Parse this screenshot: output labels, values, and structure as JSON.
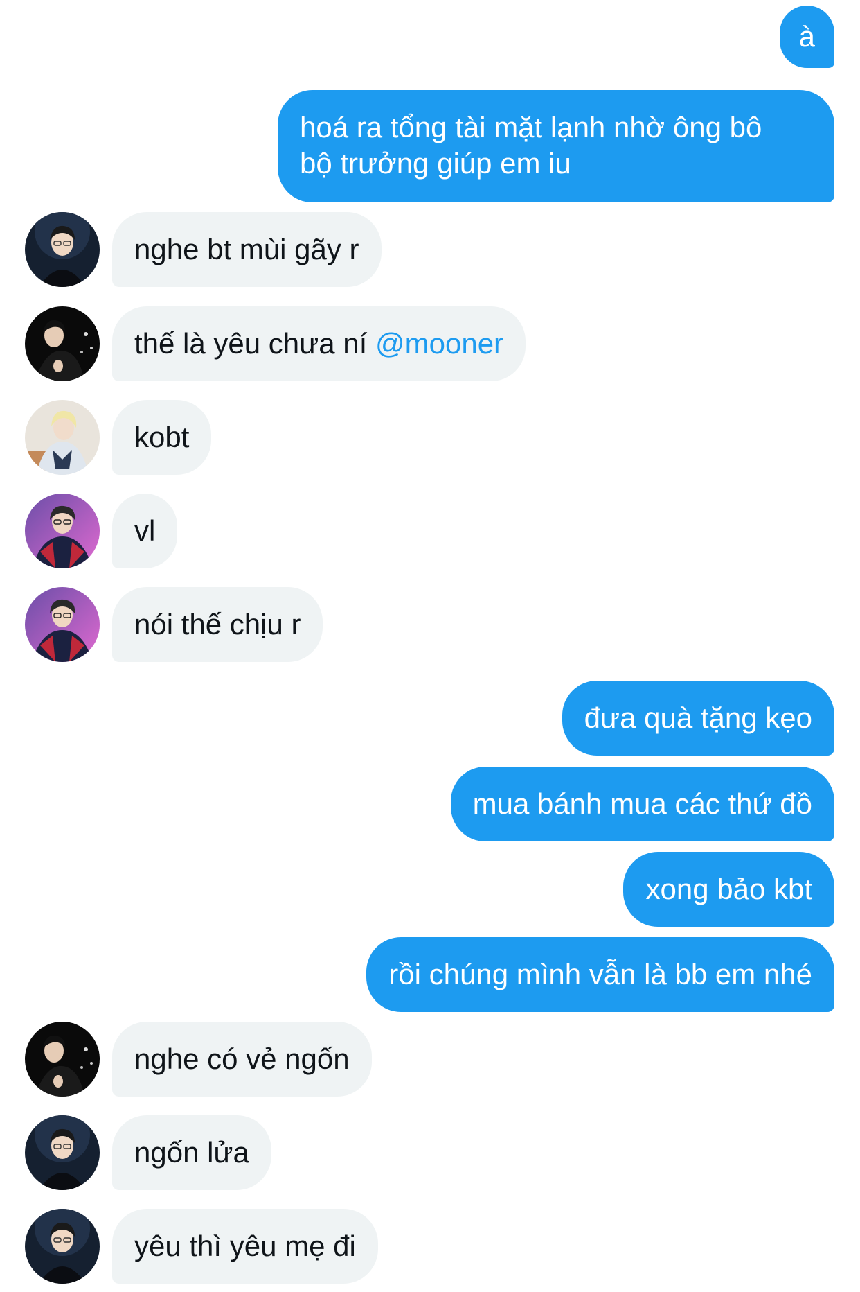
{
  "messages": [
    {
      "id": "m1",
      "side": "out",
      "text": "à"
    },
    {
      "id": "m2",
      "side": "out",
      "text": "hoá ra tổng tài mặt lạnh nhờ ông bô bộ trưởng giúp em iu"
    },
    {
      "id": "m3",
      "side": "in",
      "avatar": "avatar-a",
      "text": "nghe bt mùi gãy r"
    },
    {
      "id": "m4",
      "side": "in",
      "avatar": "avatar-b",
      "text": "thế là yêu chưa ní ",
      "mention": "@mooner"
    },
    {
      "id": "m5",
      "side": "in",
      "avatar": "avatar-c",
      "text": "kobt"
    },
    {
      "id": "m6",
      "side": "in",
      "avatar": "avatar-d",
      "text": "vl"
    },
    {
      "id": "m7",
      "side": "in",
      "avatar": "avatar-d",
      "text": "nói thế chịu r"
    },
    {
      "id": "m8",
      "side": "out",
      "text": "đưa quà tặng kẹo"
    },
    {
      "id": "m9",
      "side": "out",
      "text": "mua bánh mua các thứ đồ"
    },
    {
      "id": "m10",
      "side": "out",
      "text": "xong bảo kbt"
    },
    {
      "id": "m11",
      "side": "out",
      "text": "rồi chúng mình vẫn là bb em nhé"
    },
    {
      "id": "m12",
      "side": "in",
      "avatar": "avatar-b",
      "text": "nghe có vẻ ngốn"
    },
    {
      "id": "m13",
      "side": "in",
      "avatar": "avatar-a",
      "text": "ngốn lửa"
    },
    {
      "id": "m14",
      "side": "in",
      "avatar": "avatar-a",
      "text": "yêu thì yêu mẹ đi"
    }
  ],
  "colors": {
    "outgoing_bubble": "#1d9bf0",
    "outgoing_text": "#ffffff",
    "incoming_bubble": "#eff3f4",
    "incoming_text": "#0f1419",
    "mention": "#1d9bf0",
    "background": "#ffffff"
  },
  "icons": {
    "avatar-a": "user-avatar-dark-hoodie",
    "avatar-b": "user-avatar-black-background",
    "avatar-c": "user-avatar-blonde-jersey",
    "avatar-d": "user-avatar-purple-background-jersey"
  }
}
